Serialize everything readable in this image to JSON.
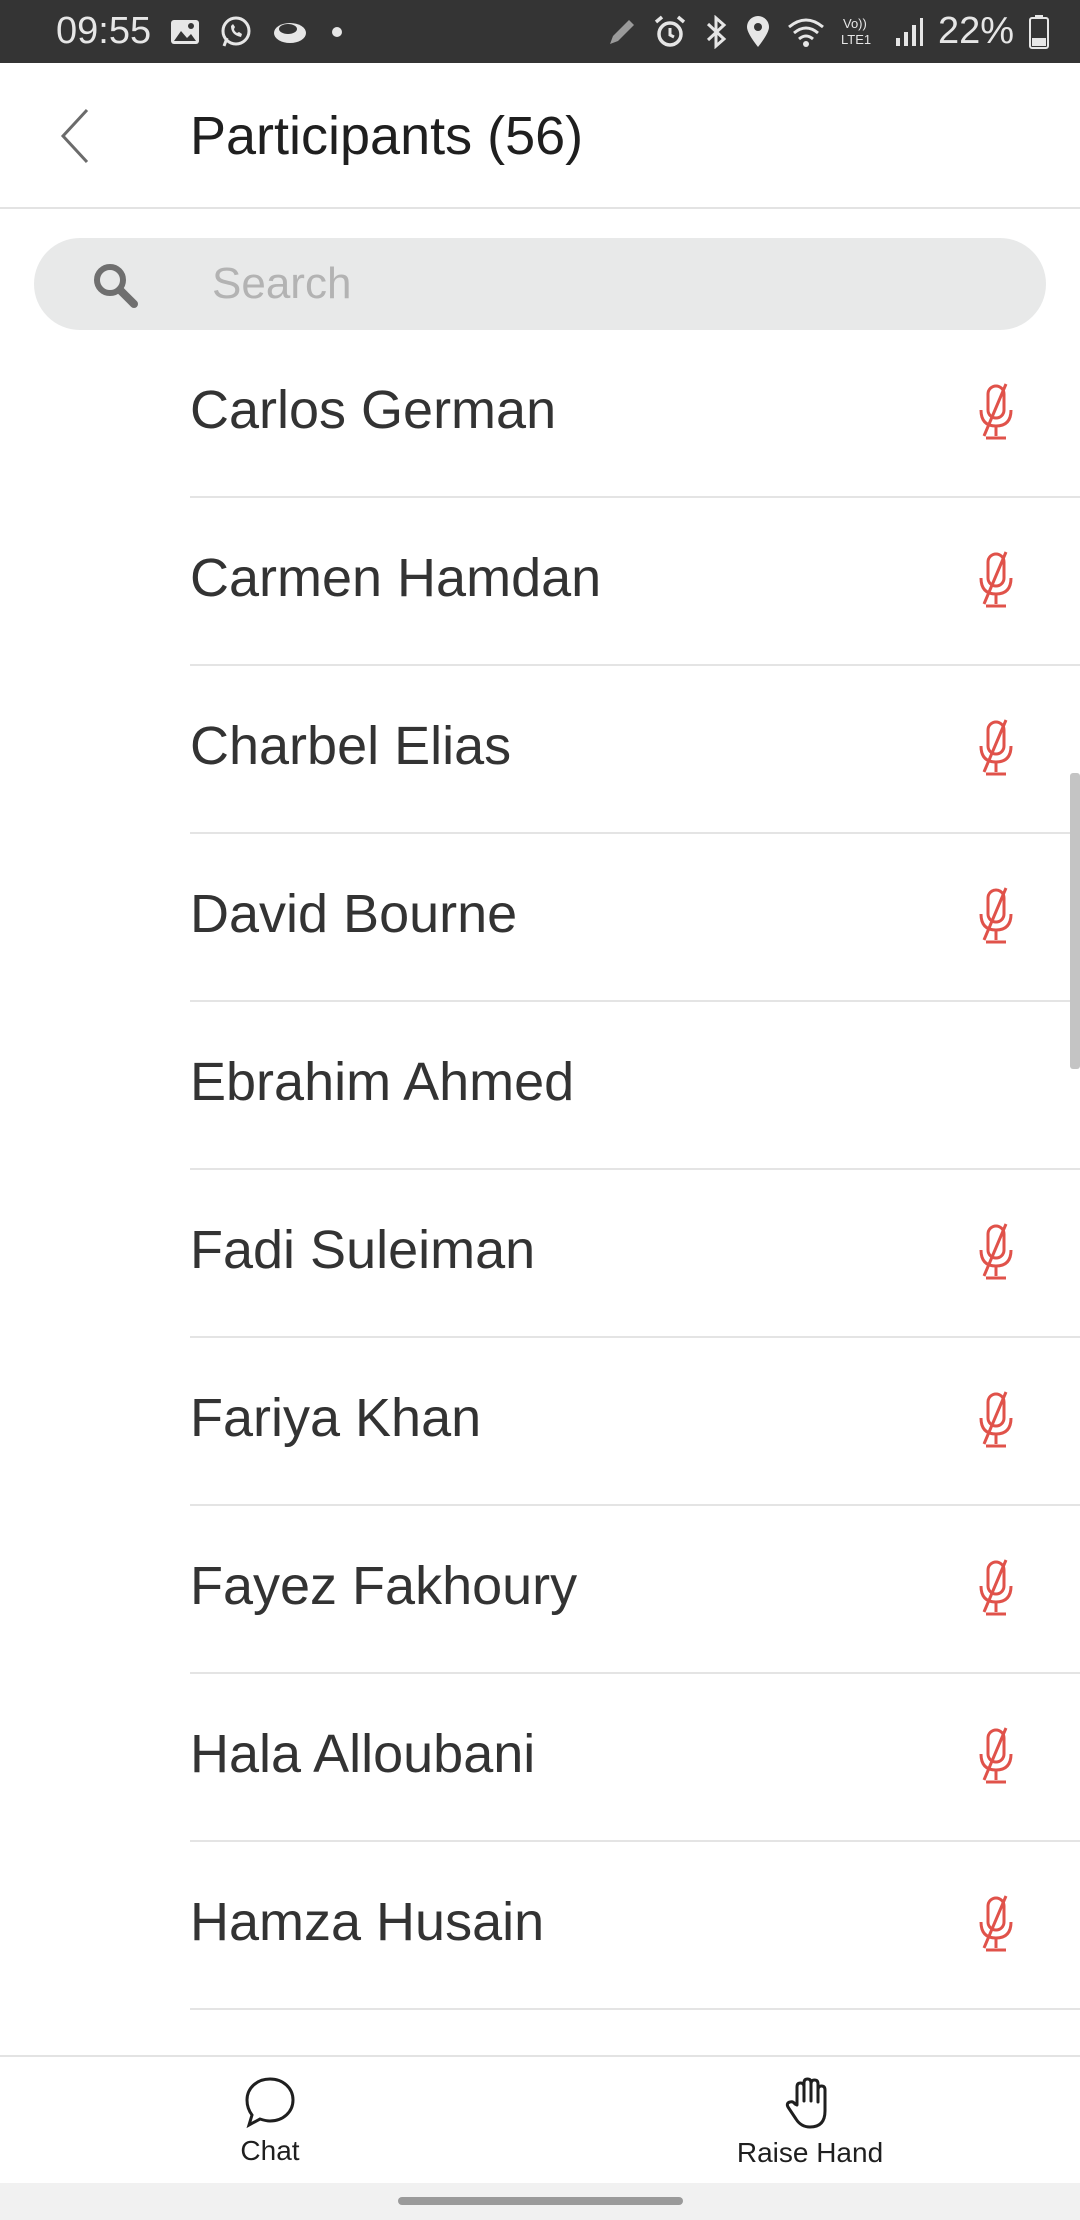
{
  "status_bar": {
    "time": "09:55",
    "battery": "22%",
    "left_icons": [
      "gallery-icon",
      "whatsapp-icon",
      "cloud-icon",
      "dot-icon"
    ],
    "right_icons": [
      "pen-icon",
      "alarm-icon",
      "bluetooth-icon",
      "location-icon",
      "wifi-icon",
      "volte-icon",
      "signal-icon",
      "battery-icon"
    ],
    "volte_text": "Vo))\nLTE1"
  },
  "header": {
    "title": "Participants (56)",
    "back_icon": "chevron-left-icon"
  },
  "search": {
    "placeholder": "Search",
    "value": ""
  },
  "participants": [
    {
      "name": "Carlos German",
      "muted": true
    },
    {
      "name": "Carmen Hamdan",
      "muted": true
    },
    {
      "name": "Charbel Elias",
      "muted": true
    },
    {
      "name": "David Bourne",
      "muted": true
    },
    {
      "name": "Ebrahim Ahmed",
      "muted": false
    },
    {
      "name": "Fadi Suleiman",
      "muted": true
    },
    {
      "name": "Fariya Khan",
      "muted": true
    },
    {
      "name": "Fayez Fakhoury",
      "muted": true
    },
    {
      "name": "Hala Alloubani",
      "muted": true
    },
    {
      "name": "Hamza Husain",
      "muted": true
    }
  ],
  "bottom_bar": {
    "chat_label": "Chat",
    "raise_hand_label": "Raise Hand"
  },
  "colors": {
    "status_bar_bg": "#343434",
    "muted_mic": "#e0524a",
    "text": "#333333",
    "search_bg": "#e8e9e9"
  }
}
